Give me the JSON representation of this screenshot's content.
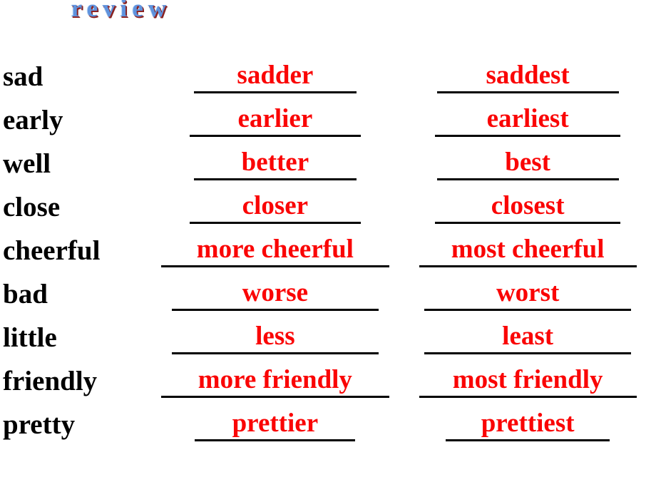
{
  "slide": {
    "title": "review",
    "background_color": "#ffffff",
    "base_word_color": "#000000",
    "answer_color": "#fa0505",
    "rule_color": "#000000",
    "title_fill_color": "#5f93de",
    "title_shadow_color": "#8f2424"
  },
  "table": {
    "rows": [
      {
        "base": "sad",
        "comparative": "sadder",
        "superlative": "saddest"
      },
      {
        "base": "early",
        "comparative": "earlier",
        "superlative": "earliest"
      },
      {
        "base": "well",
        "comparative": "better",
        "superlative": "best"
      },
      {
        "base": "close",
        "comparative": "closer",
        "superlative": "closest"
      },
      {
        "base": "cheerful",
        "comparative": "more cheerful",
        "superlative": "most cheerful"
      },
      {
        "base": "bad",
        "comparative": "worse",
        "superlative": "worst"
      },
      {
        "base": "little",
        "comparative": "less",
        "superlative": "least"
      },
      {
        "base": "friendly",
        "comparative": "more friendly",
        "superlative": "most friendly"
      },
      {
        "base": "pretty",
        "comparative": "prettier",
        "superlative": "prettiest"
      }
    ]
  }
}
